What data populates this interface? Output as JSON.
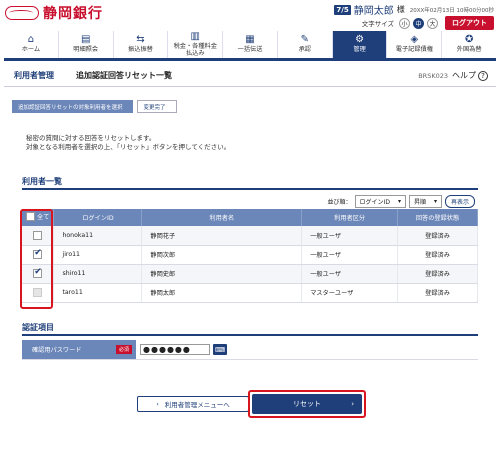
{
  "header": {
    "bank_name": "静岡銀行",
    "user_id_badge": "7/5",
    "user_name": "静岡太郎",
    "user_suffix": "様",
    "login_datetime": "20XX年02月13日 10時00分00秒",
    "font_size_label": "文字サイズ",
    "font_sizes": [
      "小",
      "中",
      "大"
    ],
    "font_size_selected": "中",
    "logout_label": "ログアウト"
  },
  "nav": {
    "items": [
      {
        "label": "ホーム",
        "icon": "home-icon",
        "glyph": "⌂"
      },
      {
        "label": "明細照会",
        "icon": "list-icon",
        "glyph": "▤"
      },
      {
        "label": "振込振替",
        "icon": "transfer-icon",
        "glyph": "⇆"
      },
      {
        "label": "税金・各種料金\n払込み",
        "icon": "payment-icon",
        "glyph": "▥"
      },
      {
        "label": "一括伝送",
        "icon": "batch-icon",
        "glyph": "▦"
      },
      {
        "label": "承認",
        "icon": "approve-icon",
        "glyph": "✎"
      },
      {
        "label": "管理",
        "icon": "admin-icon",
        "glyph": "⚙"
      },
      {
        "label": "電子記録債権",
        "icon": "ecredit-icon",
        "glyph": "◈"
      },
      {
        "label": "外国為替",
        "icon": "forex-icon",
        "glyph": "✪"
      }
    ],
    "active_index": 6
  },
  "page": {
    "category": "利用者管理",
    "title": "追加認証回答リセット一覧",
    "code": "BRSK023",
    "help_label": "ヘルプ"
  },
  "steps": {
    "current": "追加認証回答リセットの対象利用者を選択",
    "next": "変更完了"
  },
  "intro": {
    "line1": "秘密の質問に対する回答をリセットします。",
    "line2": "対象となる利用者を選択の上、「リセット」ボタンを押してください。"
  },
  "users_section": {
    "title": "利用者一覧",
    "sort_label": "並び順：",
    "sort_field": "ログインID",
    "sort_order": "昇順",
    "redisplay_label": "再表示",
    "select_all_label": "全て",
    "columns": [
      "ログインID",
      "利用者名",
      "利用者区分",
      "回答の登録状態"
    ],
    "rows": [
      {
        "login_id": "honoka11",
        "name": "静岡花子",
        "type": "一般ユーザ",
        "status": "登録済み",
        "checked": false,
        "disabled": false
      },
      {
        "login_id": "jiro11",
        "name": "静岡次郎",
        "type": "一般ユーザ",
        "status": "登録済み",
        "checked": true,
        "disabled": false
      },
      {
        "login_id": "shiro11",
        "name": "静岡史郎",
        "type": "一般ユーザ",
        "status": "登録済み",
        "checked": true,
        "disabled": false
      },
      {
        "login_id": "taro11",
        "name": "静岡太郎",
        "type": "マスターユーザ",
        "status": "登録済み",
        "checked": false,
        "disabled": true
      }
    ]
  },
  "auth_section": {
    "title": "認証項目",
    "password_label": "確認用パスワード",
    "required_label": "必須",
    "password_value": "●●●●●●"
  },
  "buttons": {
    "back_label": "利用者管理メニューへ",
    "reset_label": "リセット"
  },
  "colors": {
    "brand_red": "#c8102e",
    "navy": "#1f3f7a",
    "table_header": "#6b86b8",
    "highlight_frame": "#d8141e"
  }
}
